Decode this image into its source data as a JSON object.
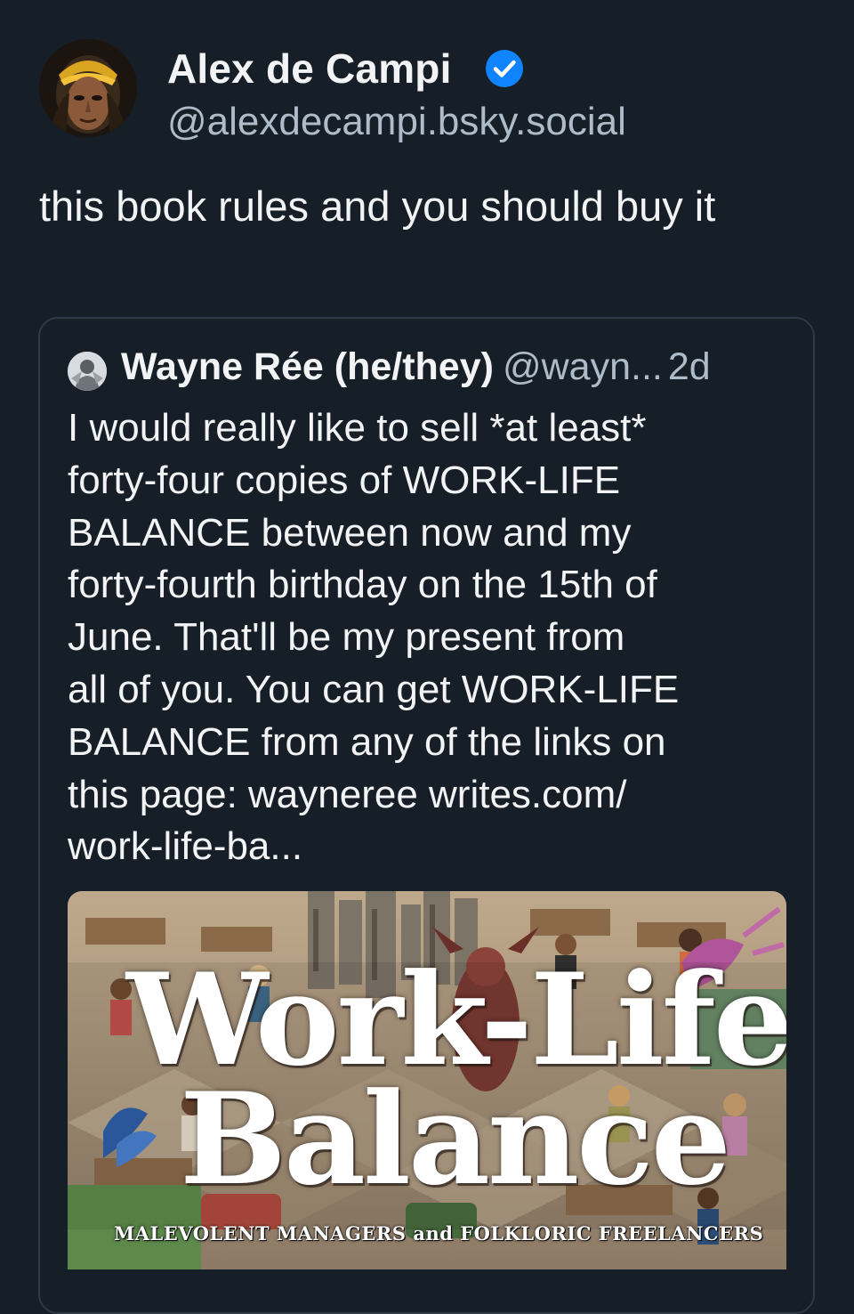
{
  "post": {
    "author_name": "Alex de Campi",
    "author_handle": "@alexdecampi.bsky.social",
    "verified": true,
    "text": "this book rules and you should buy it"
  },
  "quote": {
    "author_name": "Wayne Rée (he/they)",
    "author_handle": "@wayn...",
    "timestamp": "2d",
    "text_lines": [
      "I would really like to sell *at least*",
      "forty-four copies of WORK-LIFE",
      "BALANCE between now and my",
      "forty-fourth birthday on the 15th of",
      "June. That'll be my present from",
      "all of you. You can get WORK-LIFE",
      "BALANCE from any of the links on",
      "this page: wayneree writes.com/",
      "work-life-ba..."
    ],
    "image": {
      "title_line_1": "Work-Life",
      "title_line_2": "Balance",
      "subtitle": "MALEVOLENT MANAGERS and FOLKLORIC FREELANCERS"
    }
  },
  "colors": {
    "background": "#161e27",
    "text_primary": "#f1f3f5",
    "text_secondary": "#aebbc9",
    "verified_badge": "#1083fe",
    "card_border": "#2e3a48"
  },
  "icons": {
    "verified": "verified-check-icon"
  }
}
